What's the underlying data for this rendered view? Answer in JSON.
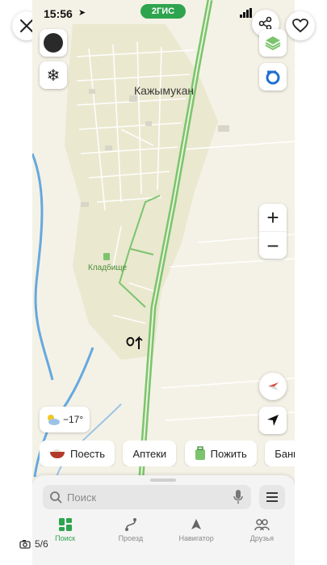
{
  "status": {
    "time": "15:56",
    "brand": "2ГИС"
  },
  "map": {
    "town_label": "Кажымукан",
    "cemetery_label": "Кладбище",
    "colors": {
      "land": "#f4f2e6",
      "town": "#eae8cf",
      "road": "#7bc46d",
      "river": "#66a8df"
    }
  },
  "controls": {
    "zoom_in": "+",
    "zoom_out": "−"
  },
  "weather": {
    "temp": "−17°"
  },
  "chips": [
    {
      "label": "Поесть",
      "icon": "bowl-icon"
    },
    {
      "label": "Аптеки",
      "icon": ""
    },
    {
      "label": "Пожить",
      "icon": "suitcase-icon"
    },
    {
      "label": "Банкоматы",
      "icon": ""
    }
  ],
  "search": {
    "placeholder": "Поиск"
  },
  "tabs": [
    {
      "label": "Поиск",
      "icon": "grid-icon",
      "active": true
    },
    {
      "label": "Проезд",
      "icon": "route-icon",
      "active": false
    },
    {
      "label": "Навигатор",
      "icon": "navigator-icon",
      "active": false
    },
    {
      "label": "Друзья",
      "icon": "friends-icon",
      "active": false
    }
  ],
  "viewer": {
    "counter": "5/6"
  }
}
